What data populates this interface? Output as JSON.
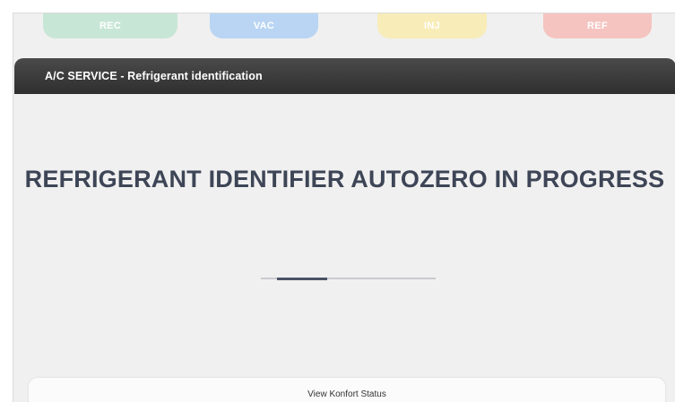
{
  "phase_tabs": [
    {
      "label": "REC",
      "color": "#c8e6d6"
    },
    {
      "label": "VAC",
      "color": "#b9d5f3"
    },
    {
      "label": "INJ",
      "color": "#f8ecb8"
    },
    {
      "label": "REF",
      "color": "#f5c4c0"
    }
  ],
  "header": {
    "title": "A/C SERVICE - Refrigerant identification"
  },
  "main": {
    "status_message": "REFRIGERANT IDENTIFIER AUTOZERO IN PROGRESS",
    "progress": {
      "start_fraction": 0.09,
      "end_fraction": 0.38
    }
  },
  "footer": {
    "view_status_label": "View Konfort Status"
  },
  "colors": {
    "header_background": "#2f2f2f",
    "message_text": "#3d4556",
    "progress_fill": "#4a5265",
    "progress_track": "#c9cbd0"
  }
}
